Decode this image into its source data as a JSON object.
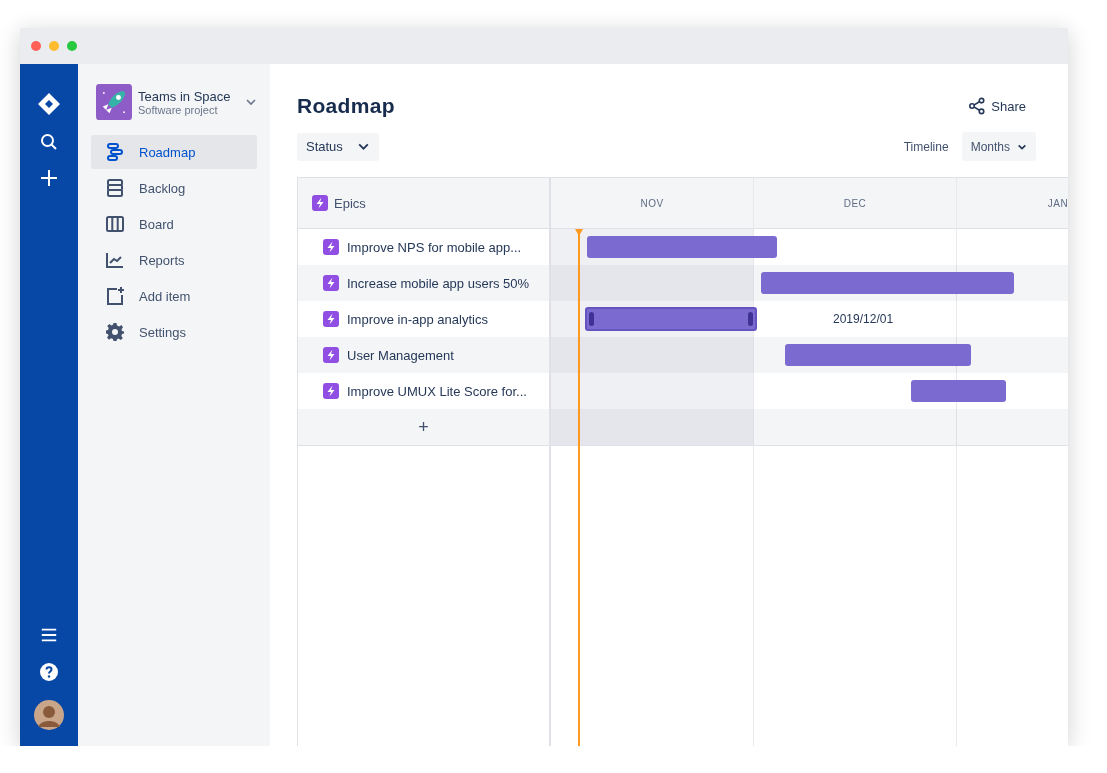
{
  "rail": {
    "items": [
      {
        "kind": "logo"
      },
      {
        "kind": "search"
      },
      {
        "kind": "create"
      }
    ],
    "bottom": [
      {
        "kind": "menu"
      },
      {
        "kind": "help"
      },
      {
        "kind": "avatar"
      }
    ]
  },
  "project": {
    "name": "Teams in Space",
    "type": "Software project"
  },
  "sidebar": {
    "items": [
      {
        "label": "Roadmap",
        "selected": true
      },
      {
        "label": "Backlog",
        "selected": false
      },
      {
        "label": "Board",
        "selected": false
      },
      {
        "label": "Reports",
        "selected": false
      },
      {
        "label": "Add item",
        "selected": false
      },
      {
        "label": "Settings",
        "selected": false
      }
    ]
  },
  "page": {
    "title": "Roadmap",
    "share": "Share",
    "status_filter": "Status",
    "timeline_label": "Timeline",
    "timeline_scale": "Months"
  },
  "roadmap": {
    "column_title": "Epics",
    "months": [
      {
        "label": "NOV",
        "current": true
      },
      {
        "label": "DEC",
        "current": false
      },
      {
        "label": "JAN",
        "current": false
      }
    ],
    "epics": [
      {
        "title": "Improve NPS for mobile app...",
        "selected": false
      },
      {
        "title": "Increase mobile app users 50%",
        "selected": false
      },
      {
        "title": "Improve in-app analytics",
        "selected": true,
        "date_label": "2019/12/01"
      },
      {
        "title": "User Management",
        "selected": false
      },
      {
        "title": "Improve UMUX Lite Score for...",
        "selected": false
      }
    ],
    "add": "+"
  }
}
